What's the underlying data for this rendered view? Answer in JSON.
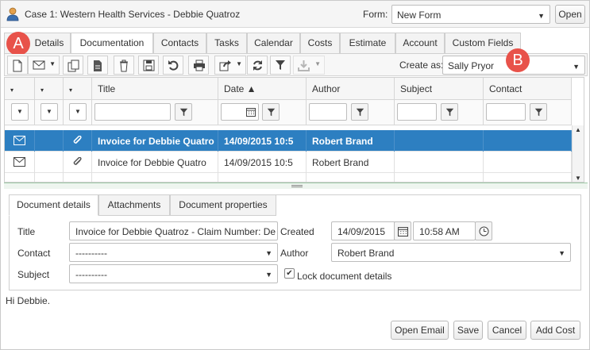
{
  "window": {
    "title": "Case 1: Western Health Services - Debbie Quatroz",
    "form_label": "Form:",
    "form_value": "New Form",
    "open_label": "Open"
  },
  "tabs": [
    {
      "label": "Details",
      "active": false
    },
    {
      "label": "Documentation",
      "active": true
    },
    {
      "label": "Contacts",
      "active": false
    },
    {
      "label": "Tasks",
      "active": false
    },
    {
      "label": "Calendar",
      "active": false
    },
    {
      "label": "Costs",
      "active": false
    },
    {
      "label": "Estimate",
      "active": false
    },
    {
      "label": "Account",
      "active": false
    },
    {
      "label": "Custom Fields",
      "active": false
    }
  ],
  "badges": {
    "a": "A",
    "b": "B",
    "color": "#e8524a"
  },
  "toolbar": {
    "icons": [
      "new-document-icon",
      "email-icon",
      "copy-icon",
      "document-icon",
      "delete-icon",
      "save-icon",
      "undo-icon",
      "print-icon",
      "share-icon",
      "refresh-icon",
      "filter-icon",
      "download-icon"
    ],
    "create_as_label": "Create as:",
    "create_as_value": "Sally Pryor"
  },
  "grid": {
    "columns": [
      "Title",
      "Date ▲",
      "Author",
      "Subject",
      "Contact"
    ],
    "rows": [
      {
        "title": "Invoice for Debbie Quatro",
        "date": "14/09/2015 10:5",
        "author": "Robert Brand",
        "subject": "",
        "contact": "",
        "selected": true
      },
      {
        "title": "Invoice for Debbie Quatro",
        "date": "14/09/2015 10:5",
        "author": "Robert Brand",
        "subject": "",
        "contact": "",
        "selected": false
      }
    ],
    "selected_color": "#2d7fc1"
  },
  "details": {
    "tabs": [
      "Document details",
      "Attachments",
      "Document properties"
    ],
    "title_label": "Title",
    "title_value": "Invoice for Debbie Quatroz - Claim Number: De",
    "created_label": "Created",
    "created_date": "14/09/2015",
    "created_time": "10:58 AM",
    "contact_label": "Contact",
    "contact_value": "----------",
    "author_label": "Author",
    "author_value": "Robert Brand",
    "subject_label": "Subject",
    "subject_value": "----------",
    "lock_label": "Lock document details",
    "lock_checked": true
  },
  "body_text": "Hi Debbie.",
  "buttons": {
    "open_email": "Open Email",
    "save": "Save",
    "cancel": "Cancel",
    "add_cost": "Add Cost"
  }
}
